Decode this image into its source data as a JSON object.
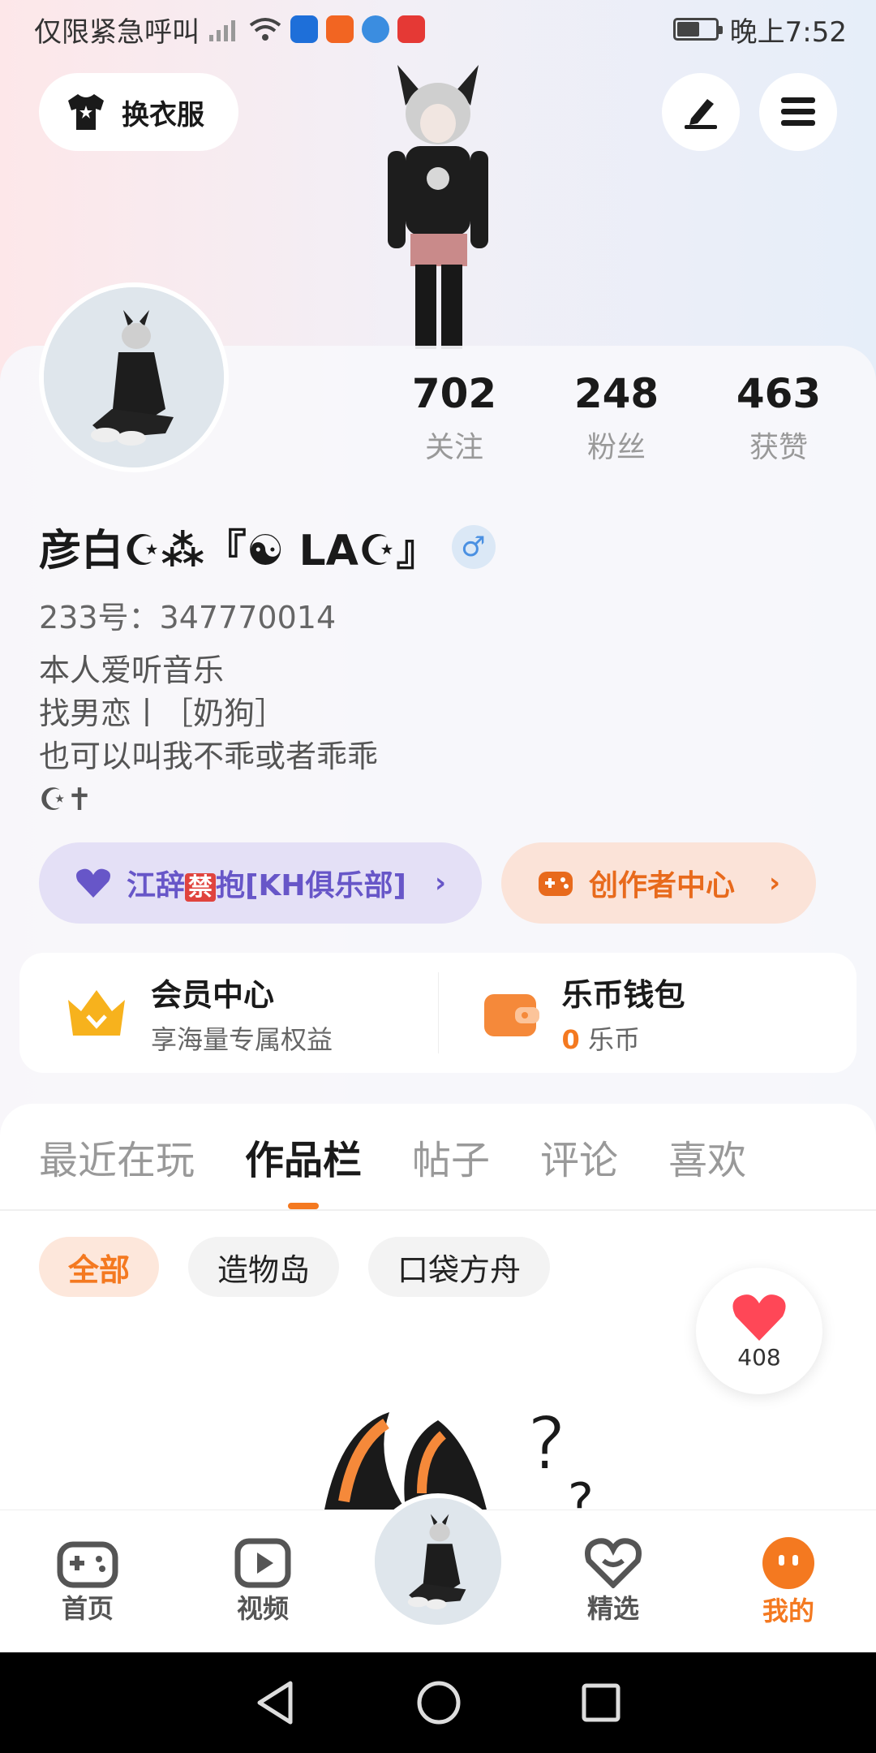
{
  "status_bar": {
    "left_text": "仅限紧急呼叫",
    "time": "晚上7:52"
  },
  "header": {
    "outfit_label": "换衣服"
  },
  "stats": [
    {
      "value": "702",
      "label": "关注"
    },
    {
      "value": "248",
      "label": "粉丝"
    },
    {
      "value": "463",
      "label": "获赞"
    }
  ],
  "profile": {
    "nickname": "彦白☪︎⁂『☯ LA☪︎』",
    "gender_symbol": "♂",
    "uid_text": "233号：347770014",
    "bio_lines": [
      "本人爱听音乐",
      "找男恋丨［奶狗］",
      "也可以叫我不乖或者乖乖",
      "☪︎✝"
    ]
  },
  "pills": {
    "group_prefix": "江辞",
    "group_badge": "禁",
    "group_suffix": "抱[KH俱乐部]",
    "creator_label": "创作者中心"
  },
  "vip": {
    "member_title": "会员中心",
    "member_sub": "享海量专属权益",
    "wallet_title": "乐币钱包",
    "wallet_amount": "0",
    "wallet_unit": "乐币"
  },
  "tabs": [
    "最近在玩",
    "作品栏",
    "帖子",
    "评论",
    "喜欢"
  ],
  "active_tab": "作品栏",
  "filters": [
    "全部",
    "造物岛",
    "口袋方舟"
  ],
  "like_count": "408",
  "bottom_nav": [
    "首页",
    "视频",
    "精选",
    "我的"
  ],
  "colors": {
    "accent": "#f47920",
    "purple": "#6756c8"
  }
}
